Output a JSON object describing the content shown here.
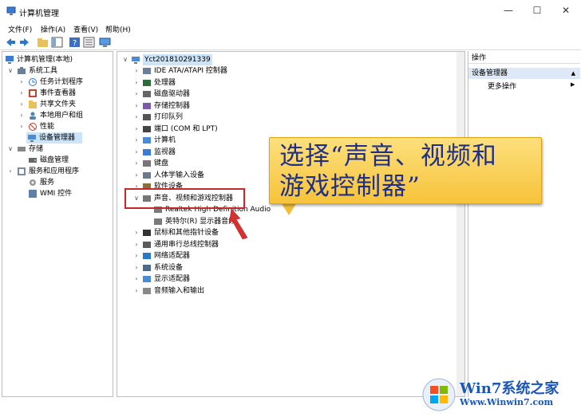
{
  "window": {
    "title": "计算机管理",
    "minimize": "—",
    "maximize": "☐",
    "close": "✕"
  },
  "menubar": [
    "文件(F)",
    "操作(A)",
    "查看(V)",
    "帮助(H)"
  ],
  "left_tree": [
    {
      "label": "计算机管理(本地)",
      "arrow": "",
      "level": 0
    },
    {
      "label": "系统工具",
      "arrow": "∨",
      "level": 1
    },
    {
      "label": "任务计划程序",
      "arrow": "›",
      "level": 2
    },
    {
      "label": "事件查看器",
      "arrow": "›",
      "level": 2
    },
    {
      "label": "共享文件夹",
      "arrow": "›",
      "level": 2
    },
    {
      "label": "本地用户和组",
      "arrow": "›",
      "level": 2
    },
    {
      "label": "性能",
      "arrow": "›",
      "level": 2
    },
    {
      "label": "设备管理器",
      "arrow": "",
      "level": 2,
      "selected": true
    },
    {
      "label": "存储",
      "arrow": "∨",
      "level": 1
    },
    {
      "label": "磁盘管理",
      "arrow": "",
      "level": 2
    },
    {
      "label": "服务和应用程序",
      "arrow": "›",
      "level": 1
    },
    {
      "label": "服务",
      "arrow": "",
      "level": 2
    },
    {
      "label": "WMI 控件",
      "arrow": "",
      "level": 2
    }
  ],
  "device_tree": {
    "root": "Yct201810291339",
    "root_arrow": "∨",
    "items": [
      {
        "label": "IDE ATA/ATAPI 控制器",
        "arrow": "›"
      },
      {
        "label": "处理器",
        "arrow": "›"
      },
      {
        "label": "磁盘驱动器",
        "arrow": "›"
      },
      {
        "label": "存储控制器",
        "arrow": "›"
      },
      {
        "label": "打印队列",
        "arrow": "›"
      },
      {
        "label": "端口 (COM 和 LPT)",
        "arrow": "›"
      },
      {
        "label": "计算机",
        "arrow": "›"
      },
      {
        "label": "监视器",
        "arrow": "›"
      },
      {
        "label": "键盘",
        "arrow": "›"
      },
      {
        "label": "人体学输入设备",
        "arrow": "›"
      },
      {
        "label": "软件设备",
        "arrow": "›"
      },
      {
        "label": "声音、视频和游戏控制器",
        "arrow": "∨"
      },
      {
        "label": "Realtek High Definition Audio",
        "arrow": "",
        "child": true
      },
      {
        "label": "英特尔(R) 显示器音频",
        "arrow": "",
        "child": true
      },
      {
        "label": "鼠标和其他指针设备",
        "arrow": "›"
      },
      {
        "label": "通用串行总线控制器",
        "arrow": "›"
      },
      {
        "label": "网络适配器",
        "arrow": "›"
      },
      {
        "label": "系统设备",
        "arrow": "›"
      },
      {
        "label": "显示适配器",
        "arrow": "›"
      },
      {
        "label": "音频输入和输出",
        "arrow": "›"
      }
    ]
  },
  "actions": {
    "header": "操作",
    "section": "设备管理器",
    "more": "更多操作",
    "section_arrow": "▲",
    "more_arrow": "▶"
  },
  "callout": {
    "line1": "选择“声音、视频和",
    "line2": "游戏控制器”"
  },
  "watermark": {
    "title": "Win7系统之家",
    "url": "Www.Winwin7.com"
  },
  "colors": {
    "selection": "#cce4f7",
    "callout": "#f7c33a",
    "callout_text": "#1e2f8a",
    "highlight_box": "#c62828",
    "watermark": "#1a56b8"
  }
}
